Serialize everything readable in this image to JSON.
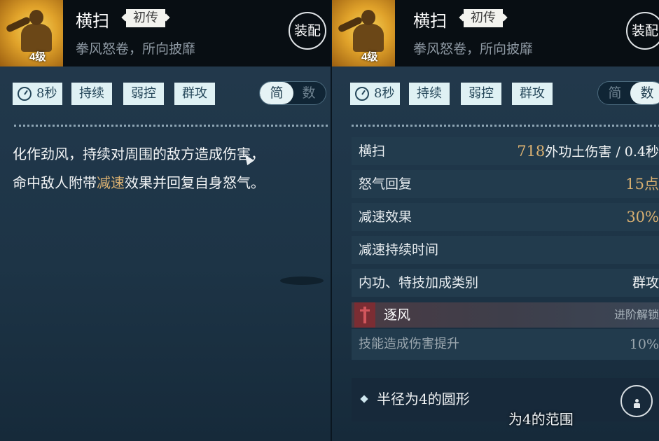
{
  "left_panel": {
    "level": "4级",
    "skill_name": "横扫",
    "tier": "初传",
    "subtitle": "拳风怒卷，所向披靡",
    "equip_label": "装配",
    "tags": {
      "cooldown": "8秒",
      "t1": "持续",
      "t2": "弱控",
      "t3": "群攻"
    },
    "toggle": {
      "simple": "简",
      "detail": "数",
      "active": "simple"
    },
    "desc": {
      "part1": "化作劲风，持续对周围的敌方造成伤害，",
      "part2": "命中敌人附带",
      "highlight": "减速",
      "part3": "效果并回复自身怒气。"
    }
  },
  "right_panel": {
    "level": "4级",
    "skill_name": "横扫",
    "tier": "初传",
    "subtitle": "拳风怒卷，所向披靡",
    "equip_label": "装配",
    "tags": {
      "cooldown": "8秒",
      "t1": "持续",
      "t2": "弱控",
      "t3": "群攻"
    },
    "toggle": {
      "simple": "简",
      "detail": "数",
      "active": "detail"
    },
    "stats": [
      {
        "label": "横扫",
        "num": "718",
        "suffix": "外功土伤害 / 0.4秒"
      },
      {
        "label": "怒气回复",
        "num": "15点",
        "suffix": ""
      },
      {
        "label": "减速效果",
        "num": "30%",
        "suffix": ""
      },
      {
        "label": "减速持续时间",
        "num": "",
        "suffix": ""
      },
      {
        "label": "内功、特技加成类别",
        "num": "",
        "suffix": "群攻"
      }
    ],
    "locked": {
      "name": "逐风",
      "status": "进阶解锁"
    },
    "boost": {
      "label": "技能造成伤害提升",
      "value": "10%"
    },
    "range": {
      "text": "半径为4的圆形"
    },
    "overlay_subtitle": "为4的范围"
  }
}
